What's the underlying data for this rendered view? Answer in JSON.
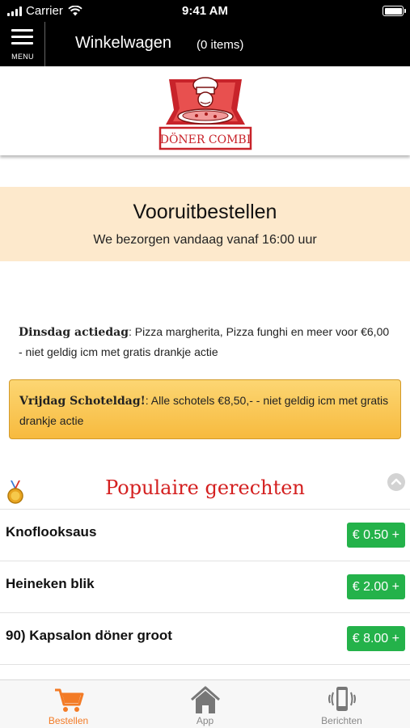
{
  "status_bar": {
    "carrier": "Carrier",
    "time": "9:41 AM"
  },
  "nav": {
    "menu_label": "MENU",
    "title": "Winkelwagen",
    "items_count": "(0 items)"
  },
  "logo": {
    "text": "DÖNER COMBI"
  },
  "preorder": {
    "title": "Vooruitbestellen",
    "subtitle": "We bezorgen vandaag vanaf 16:00 uur"
  },
  "promos": [
    {
      "title": "Dinsdag actiedag",
      "text": ": Pizza margherita, Pizza funghi en meer voor €6,00 - niet geldig icm met gratis drankje actie"
    },
    {
      "title": "Vrijdag Schoteldag!",
      "text": ": Alle schotels €8,50,- - niet geldig icm met gratis drankje actie"
    }
  ],
  "popular": {
    "title": "Populaire gerechten",
    "items": [
      {
        "name": "Knoflooksaus",
        "price": "€ 0.50 +"
      },
      {
        "name": "Heineken blik",
        "price": "€ 2.00 +"
      },
      {
        "name": "90)  Kapsalon döner groot",
        "price": "€ 8.00 +"
      }
    ]
  },
  "tabs": [
    {
      "label": "Bestellen",
      "icon": "cart-icon",
      "active": true
    },
    {
      "label": "App",
      "icon": "home-icon",
      "active": false
    },
    {
      "label": "Berichten",
      "icon": "phone-vibrate-icon",
      "active": false
    }
  ],
  "colors": {
    "accent": "#f37b26",
    "price_green": "#24b24a",
    "heading_red": "#d42020",
    "banner_bg": "#fde9cc",
    "promo_yellow": "#f7ba3e"
  }
}
